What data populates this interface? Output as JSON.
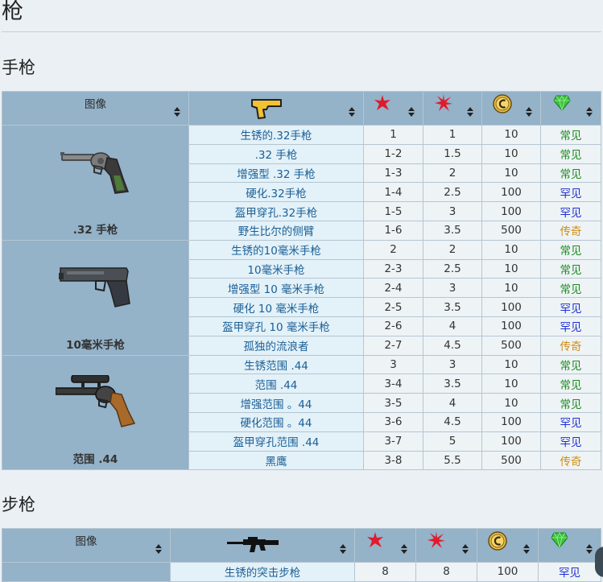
{
  "page": {
    "title": "枪"
  },
  "sections": {
    "pistols": {
      "heading": "手枪",
      "headers": {
        "image": "图像"
      },
      "groups": [
        {
          "caption": ".32 手枪"
        },
        {
          "caption": "10毫米手枪"
        },
        {
          "caption": "范围 .44"
        }
      ],
      "rows": [
        {
          "name": "生锈的.32手枪",
          "level": "1",
          "damage": "1",
          "price": "10",
          "rarity": "常见"
        },
        {
          "name": ".32 手枪",
          "level": "1-2",
          "damage": "1.5",
          "price": "10",
          "rarity": "常见"
        },
        {
          "name": "增强型 .32 手枪",
          "level": "1-3",
          "damage": "2",
          "price": "10",
          "rarity": "常见"
        },
        {
          "name": "硬化.32手枪",
          "level": "1-4",
          "damage": "2.5",
          "price": "100",
          "rarity": "罕见"
        },
        {
          "name": "盔甲穿孔.32手枪",
          "level": "1-5",
          "damage": "3",
          "price": "100",
          "rarity": "罕见"
        },
        {
          "name": "野生比尔的侧臂",
          "level": "1-6",
          "damage": "3.5",
          "price": "500",
          "rarity": "传奇"
        },
        {
          "name": "生锈的10毫米手枪",
          "level": "2",
          "damage": "2",
          "price": "10",
          "rarity": "常见"
        },
        {
          "name": "10毫米手枪",
          "level": "2-3",
          "damage": "2.5",
          "price": "10",
          "rarity": "常见"
        },
        {
          "name": "增强型 10 毫米手枪",
          "level": "2-4",
          "damage": "3",
          "price": "10",
          "rarity": "常见"
        },
        {
          "name": "硬化 10 毫米手枪",
          "level": "2-5",
          "damage": "3.5",
          "price": "100",
          "rarity": "罕见"
        },
        {
          "name": "盔甲穿孔 10 毫米手枪",
          "level": "2-6",
          "damage": "4",
          "price": "100",
          "rarity": "罕见"
        },
        {
          "name": "孤独的流浪者",
          "level": "2-7",
          "damage": "4.5",
          "price": "500",
          "rarity": "传奇"
        },
        {
          "name": "生锈范围 .44",
          "level": "3",
          "damage": "3",
          "price": "10",
          "rarity": "常见"
        },
        {
          "name": "范围 .44",
          "level": "3-4",
          "damage": "3.5",
          "price": "10",
          "rarity": "常见"
        },
        {
          "name": "增强范围 。44",
          "level": "3-5",
          "damage": "4",
          "price": "10",
          "rarity": "常见"
        },
        {
          "name": "硬化范围 。44",
          "level": "3-6",
          "damage": "4.5",
          "price": "100",
          "rarity": "罕见"
        },
        {
          "name": "盔甲穿孔范围 .44",
          "level": "3-7",
          "damage": "5",
          "price": "100",
          "rarity": "罕见"
        },
        {
          "name": "黑鹰",
          "level": "3-8",
          "damage": "5.5",
          "price": "500",
          "rarity": "传奇"
        }
      ]
    },
    "rifles": {
      "heading": "步枪",
      "headers": {
        "image": "图像"
      },
      "rows": [
        {
          "name": "生锈的突击步枪",
          "level": "8",
          "damage": "8",
          "price": "100",
          "rarity": "罕见"
        }
      ]
    }
  },
  "icons": {
    "pistol_header": "pistol-icon",
    "rifle_header": "rifle-icon",
    "level": "red-star-icon",
    "damage": "red-burst-icon",
    "price": "caps-coin-icon",
    "rarity": "green-gem-icon"
  },
  "colors": {
    "common": "#1a8a1a",
    "rare": "#1f2fd0",
    "legendary": "#d08d10",
    "link": "#1a5f96",
    "header_bg": "#94b2c8"
  }
}
